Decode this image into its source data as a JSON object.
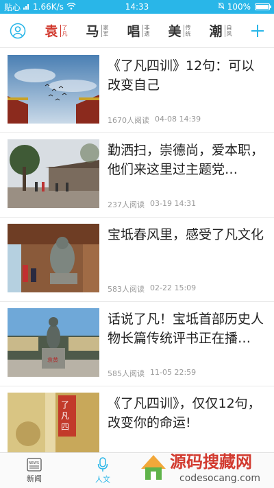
{
  "status_bar": {
    "carrier": "贴心",
    "speed": "1.66K/s",
    "time": "14:33",
    "battery": "100%"
  },
  "top_nav": {
    "tabs": [
      {
        "big": "袁",
        "small1": "了",
        "small2": "凡",
        "active": true
      },
      {
        "big": "马",
        "small1": "家",
        "small2": "军",
        "active": false
      },
      {
        "big": "唱",
        "small1": "非",
        "small2": "遗",
        "active": false
      },
      {
        "big": "美",
        "small1": "传",
        "small2": "统",
        "active": false
      },
      {
        "big": "潮",
        "small1": "自",
        "small2": "风",
        "active": false
      }
    ]
  },
  "articles": [
    {
      "title": "《了凡四训》12句：可以改变自己",
      "reads": "1670人阅读",
      "date": "04-08 14:39"
    },
    {
      "title": "勤洒扫，崇德尚，爱本职，他们来这里过主题党…",
      "reads": "237人阅读",
      "date": "03-19 14:31"
    },
    {
      "title": "宝坻春风里，感受了凡文化",
      "reads": "583人阅读",
      "date": "02-22 15:09"
    },
    {
      "title": "话说了凡！宝坻首部历史人物长篇传统评书正在播…",
      "reads": "585人阅读",
      "date": "11-05 22:59"
    },
    {
      "title": "《了凡四训》，仅仅12句，改变你的命运!",
      "reads": "",
      "date": ""
    }
  ],
  "bottom_nav": {
    "news_label": "新闻",
    "news_icon_text": "NEWS",
    "culture_label": "人文"
  },
  "watermark": {
    "title": "源码搜藏网",
    "url": "codesocang.com"
  },
  "colors": {
    "accent": "#29b6e8",
    "active_tab": "#d23a2f"
  }
}
